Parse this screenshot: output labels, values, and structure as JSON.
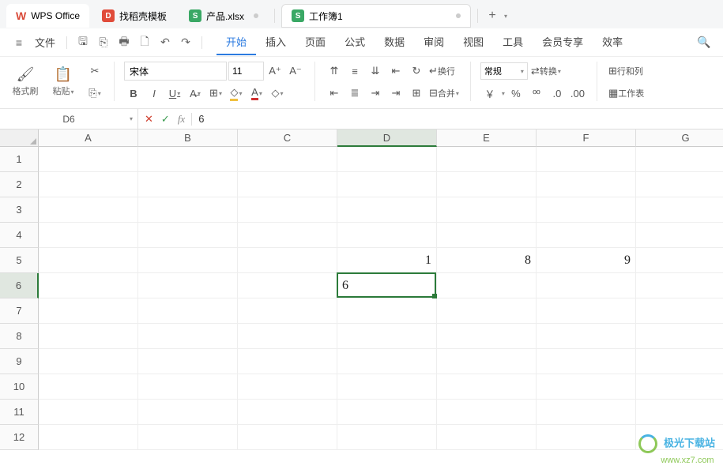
{
  "tabs": {
    "app": "WPS Office",
    "t1": "找稻壳模板",
    "t2": "产品.xlsx",
    "t3": "工作簿1",
    "plus": "+"
  },
  "menu": {
    "file": "文件",
    "tabs": [
      "开始",
      "插入",
      "页面",
      "公式",
      "数据",
      "审阅",
      "视图",
      "工具",
      "会员专享",
      "效率"
    ]
  },
  "ribbon": {
    "format_painter": "格式刷",
    "paste": "粘贴",
    "font": "宋体",
    "size": "11",
    "bold": "B",
    "italic": "I",
    "underline": "U",
    "wrap": "换行",
    "merge": "合并",
    "numfmt": "常规",
    "transpose": "转换",
    "currency": "￥",
    "percent": "%",
    "rows_cols": "行和列",
    "worksheet": "工作表"
  },
  "namebox": "D6",
  "formula": "6",
  "columns": [
    "A",
    "B",
    "C",
    "D",
    "E",
    "F",
    "G"
  ],
  "rows": [
    "1",
    "2",
    "3",
    "4",
    "5",
    "6",
    "7",
    "8",
    "9",
    "10",
    "11",
    "12"
  ],
  "cells": {
    "D5": "1",
    "E5": "8",
    "F5": "9",
    "D6": "6"
  },
  "active": {
    "col": 3,
    "row": 5
  },
  "watermark": {
    "top": "极光下载站",
    "bottom": "www.xz7.com"
  }
}
